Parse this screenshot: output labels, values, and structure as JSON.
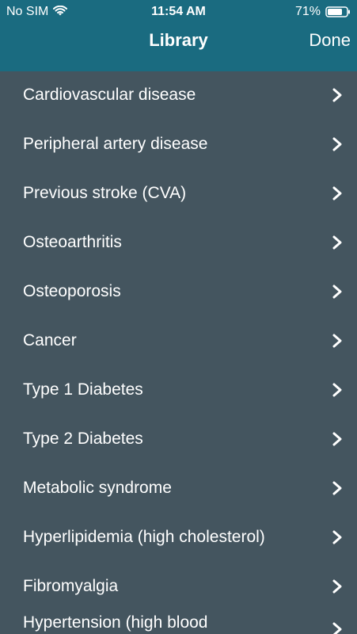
{
  "status_bar": {
    "carrier": "No SIM",
    "time": "11:54 AM",
    "battery": "71%",
    "icons": [
      "wifi-icon",
      "battery-icon"
    ]
  },
  "nav": {
    "title": "Library",
    "done_label": "Done"
  },
  "library_items": [
    {
      "label": "Cardiovascular disease"
    },
    {
      "label": "Peripheral artery disease"
    },
    {
      "label": "Previous stroke (CVA)"
    },
    {
      "label": "Osteoarthritis"
    },
    {
      "label": "Osteoporosis"
    },
    {
      "label": "Cancer"
    },
    {
      "label": "Type 1 Diabetes"
    },
    {
      "label": "Type 2 Diabetes"
    },
    {
      "label": "Metabolic syndrome"
    },
    {
      "label": "Hyperlipidemia (high cholesterol)"
    },
    {
      "label": "Fibromyalgia"
    },
    {
      "label": "Hypertension (high blood"
    }
  ],
  "colors": {
    "header_bg": "#1a6b80",
    "list_bg": "#44555f",
    "text": "#ffffff"
  }
}
